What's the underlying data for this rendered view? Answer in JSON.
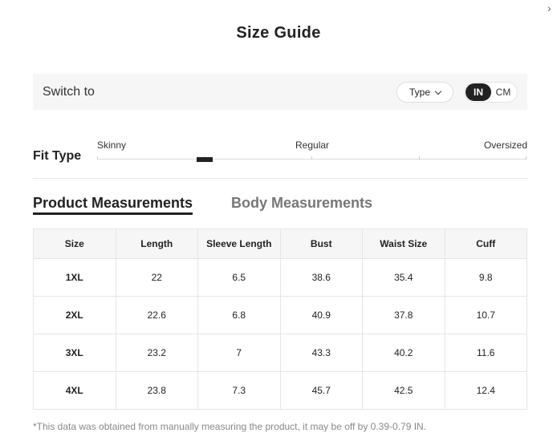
{
  "window": {
    "close_glyph": "›"
  },
  "title": "Size Guide",
  "switch_bar": {
    "label": "Switch to",
    "type_button_label": "Type",
    "units": [
      "IN",
      "CM"
    ],
    "selected_unit": "IN"
  },
  "fit_type": {
    "label": "Fit Type",
    "scale": [
      "Skinny",
      "Regular",
      "Oversized"
    ],
    "selected_position": 0.25
  },
  "tabs": [
    {
      "label": "Product Measurements",
      "active": true
    },
    {
      "label": "Body Measurements",
      "active": false
    }
  ],
  "table": {
    "headers": [
      "Size",
      "Length",
      "Sleeve Length",
      "Bust",
      "Waist Size",
      "Cuff"
    ],
    "rows": [
      [
        "1XL",
        "22",
        "6.5",
        "38.6",
        "35.4",
        "9.8"
      ],
      [
        "2XL",
        "22.6",
        "6.8",
        "40.9",
        "37.8",
        "10.7"
      ],
      [
        "3XL",
        "23.2",
        "7",
        "43.3",
        "40.2",
        "11.6"
      ],
      [
        "4XL",
        "23.8",
        "7.3",
        "45.7",
        "42.5",
        "12.4"
      ]
    ]
  },
  "note": "*This data was obtained from manually measuring the product, it may be off by 0.39-0.79 IN.",
  "colors": {
    "accent": "#222222",
    "panel": "#f6f6f6",
    "border": "#e5e5e5",
    "muted": "#888888"
  }
}
